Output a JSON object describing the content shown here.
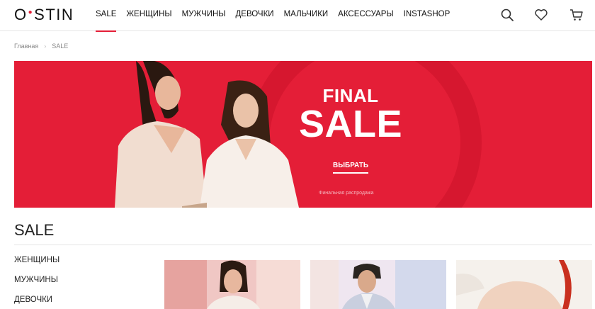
{
  "header": {
    "logo_left": "O",
    "logo_dot": "●",
    "logo_right": "STIN",
    "nav": [
      "SALE",
      "ЖЕНЩИНЫ",
      "МУЖЧИНЫ",
      "ДЕВОЧКИ",
      "МАЛЬЧИКИ",
      "АКСЕССУАРЫ",
      "INSTASHOP"
    ],
    "icons": [
      "search-icon",
      "heart-icon",
      "cart-icon"
    ]
  },
  "breadcrumb": [
    "Главная",
    "SALE"
  ],
  "banner": {
    "line1": "FINAL",
    "line2": "SALE",
    "cta": "ВЫБРАТЬ",
    "note": "Финальная распродажа"
  },
  "page_title": "SALE",
  "sidebar": [
    "ЖЕНЩИНЫ",
    "МУЖЧИНЫ",
    "ДЕВОЧКИ"
  ],
  "colors": {
    "accent": "#e41e37"
  }
}
